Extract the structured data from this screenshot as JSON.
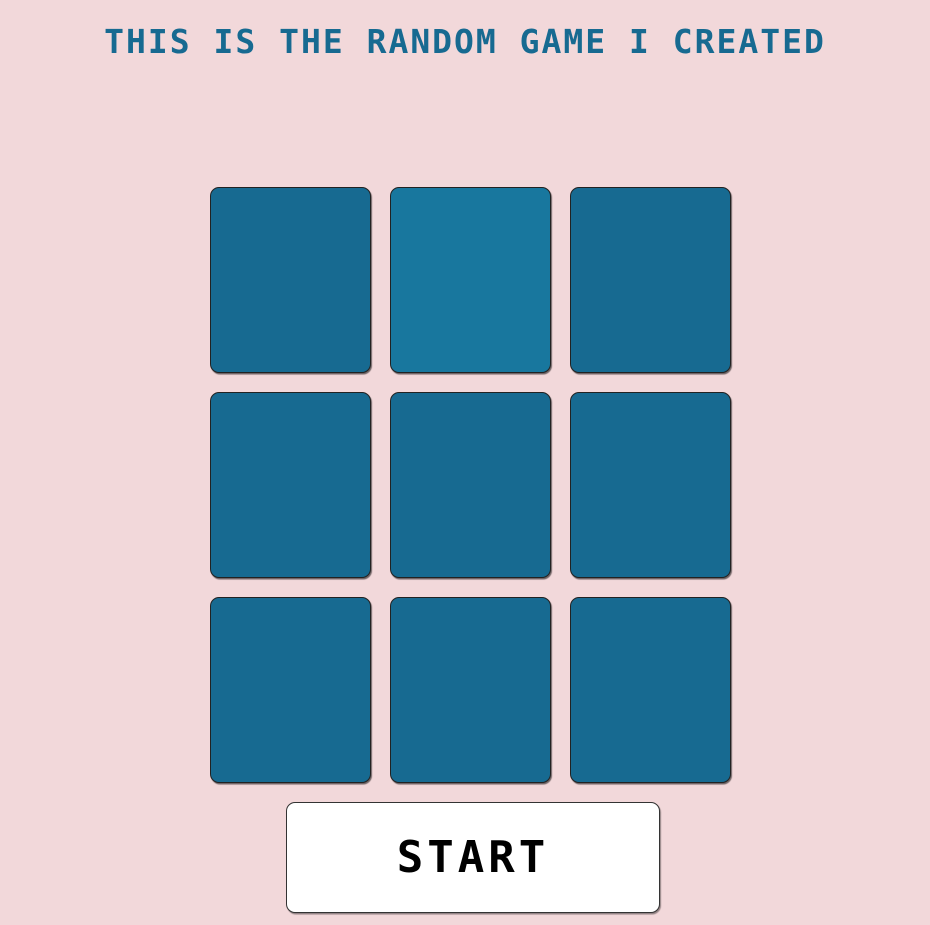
{
  "title": "THIS IS THE RANDOM GAME I CREATED",
  "colors": {
    "background": "#f2d8da",
    "tile": "#176a91",
    "tile_highlight": "#18779e",
    "title_text": "#176a91"
  },
  "board": {
    "rows": 3,
    "columns": 3,
    "tiles": [
      {
        "row": 1,
        "col": 1,
        "highlighted": false
      },
      {
        "row": 1,
        "col": 2,
        "highlighted": true
      },
      {
        "row": 1,
        "col": 3,
        "highlighted": false
      },
      {
        "row": 2,
        "col": 1,
        "highlighted": false
      },
      {
        "row": 2,
        "col": 2,
        "highlighted": false
      },
      {
        "row": 2,
        "col": 3,
        "highlighted": false
      },
      {
        "row": 3,
        "col": 1,
        "highlighted": false
      },
      {
        "row": 3,
        "col": 2,
        "highlighted": false
      },
      {
        "row": 3,
        "col": 3,
        "highlighted": false
      }
    ]
  },
  "start_button": {
    "label": "START"
  }
}
